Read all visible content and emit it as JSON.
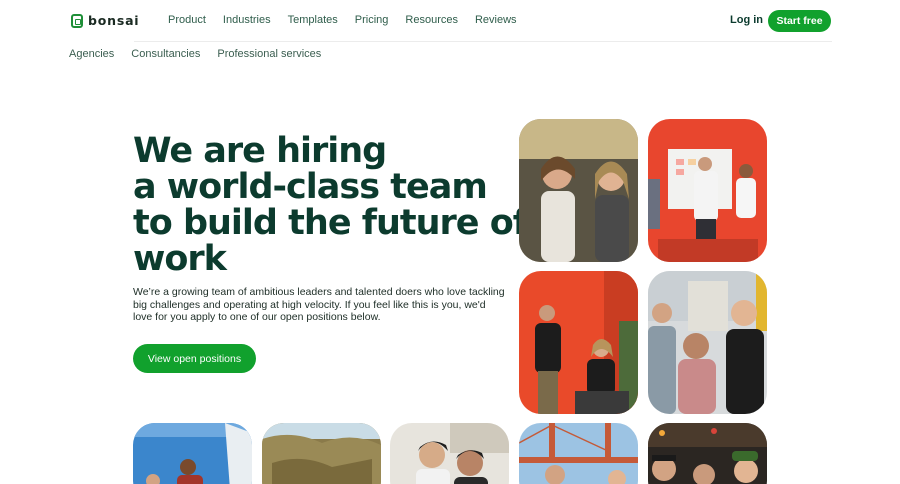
{
  "brand": {
    "name": "bonsai"
  },
  "nav": {
    "items": [
      "Product",
      "Industries",
      "Templates",
      "Pricing",
      "Resources",
      "Reviews"
    ],
    "login": "Log in",
    "start": "Start free"
  },
  "subnav": {
    "items": [
      "Agencies",
      "Consultancies",
      "Professional services"
    ]
  },
  "hero": {
    "headline": [
      "We are hiring",
      "a world-class team",
      "to build the future of",
      "work"
    ],
    "description": "We’re a growing team of ambitious leaders and talented doers who love tackling big challenges and operating at high velocity. If you feel like this is you, we'd love for you apply to one of our open positions below.",
    "cta": "View open positions"
  },
  "colors": {
    "accent": "#11a12d",
    "heading": "#0c3b2e",
    "text": "#1d2d26"
  }
}
